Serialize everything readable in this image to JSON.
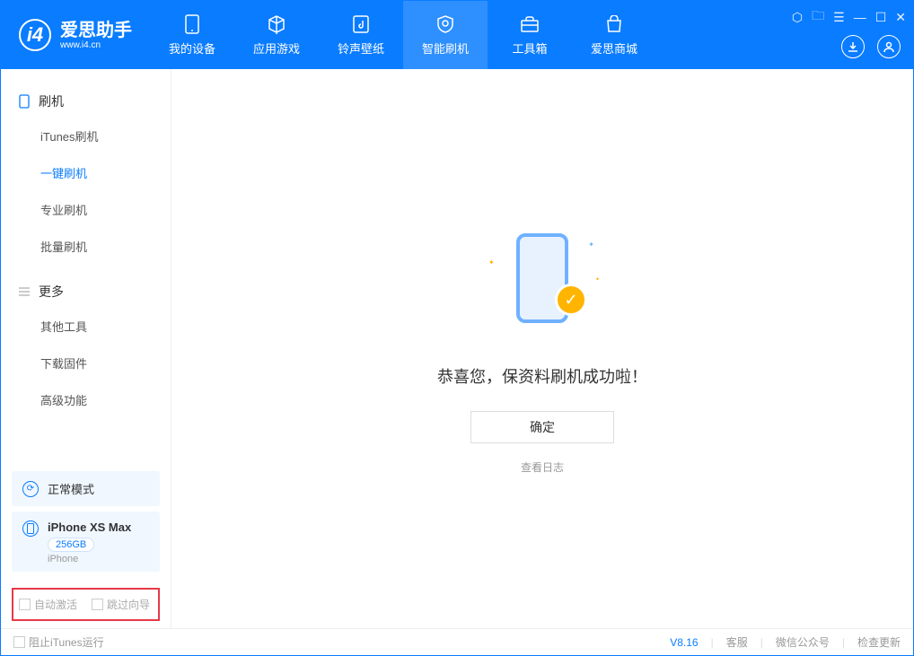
{
  "app": {
    "name_cn": "爱思助手",
    "name_en": "www.i4.cn"
  },
  "nav": {
    "tabs": [
      {
        "label": "我的设备"
      },
      {
        "label": "应用游戏"
      },
      {
        "label": "铃声壁纸"
      },
      {
        "label": "智能刷机"
      },
      {
        "label": "工具箱"
      },
      {
        "label": "爱思商城"
      }
    ]
  },
  "sidebar": {
    "flash_title": "刷机",
    "flash_items": [
      "iTunes刷机",
      "一键刷机",
      "专业刷机",
      "批量刷机"
    ],
    "more_title": "更多",
    "more_items": [
      "其他工具",
      "下载固件",
      "高级功能"
    ],
    "mode_label": "正常模式",
    "device_name": "iPhone XS Max",
    "device_capacity": "256GB",
    "device_type": "iPhone",
    "auto_activate": "自动激活",
    "skip_guide": "跳过向导"
  },
  "main": {
    "success_text": "恭喜您，保资料刷机成功啦！",
    "ok_button": "确定",
    "view_log": "查看日志"
  },
  "footer": {
    "block_itunes": "阻止iTunes运行",
    "version": "V8.16",
    "support": "客服",
    "wechat": "微信公众号",
    "check_update": "检查更新"
  }
}
